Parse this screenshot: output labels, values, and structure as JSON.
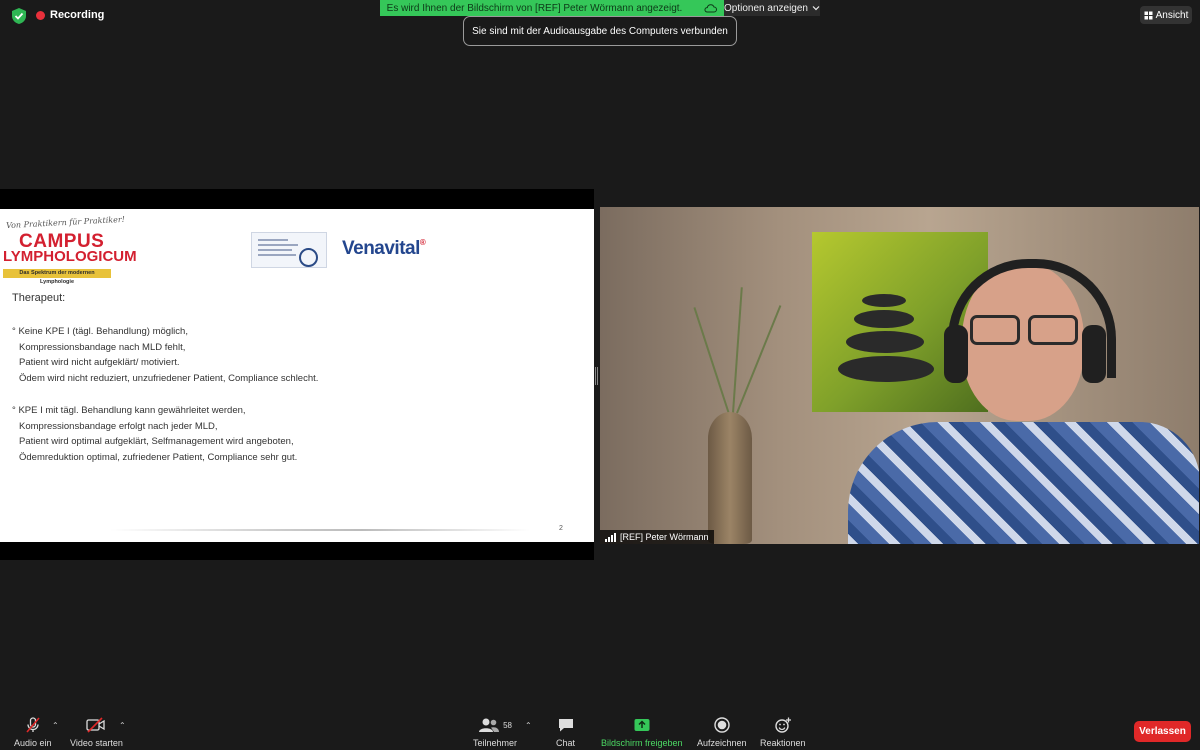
{
  "top_bar": {
    "recording_label": "Recording",
    "share_banner": "Es wird Ihnen der Bildschirm von [REF] Peter Wörmann angezeigt.",
    "options_label": "Optionen anzeigen",
    "audio_toast": "Sie sind mit der Audioausgabe des Computers verbunden",
    "view_label": "Ansicht"
  },
  "slide": {
    "logo_tagline": "Von Praktikern für Praktiker!",
    "logo_campus": "CAMPUS",
    "logo_lympho": "LYMPHOLOGICUM",
    "logo_subtitle": "Das Spektrum der modernen Lymphologie",
    "partner_logo": "Venavital",
    "partner_reg": "®",
    "title": "Therapeut:",
    "bullets": [
      {
        "marker": "°",
        "lines": [
          "Keine KPE I (tägl. Behandlung) möglich,",
          "Kompressionsbandage nach MLD fehlt,",
          "Patient wird nicht aufgeklärt/ motiviert.",
          "Ödem wird nicht reduziert, unzufriedener Patient, Compliance schlecht."
        ]
      },
      {
        "marker": "°",
        "lines": [
          "KPE I mit tägl. Behandlung kann gewährleitet werden,",
          "Kompressionsbandage erfolgt nach jeder MLD,",
          "Patient wird optimal aufgeklärt, Selfmanagement wird angeboten,",
          "Ödemreduktion optimal, zufriedener Patient, Compliance sehr gut."
        ]
      }
    ],
    "page_number": "2"
  },
  "video": {
    "participant_name": "[REF] Peter Wörmann"
  },
  "toolbar": {
    "audio_label": "Audio ein",
    "video_label": "Video starten",
    "participants_label": "Teilnehmer",
    "participants_count": "58",
    "chat_label": "Chat",
    "share_label": "Bildschirm freigeben",
    "record_label": "Aufzeichnen",
    "reactions_label": "Reaktionen",
    "leave_label": "Verlassen"
  },
  "colors": {
    "share_green": "#35c759",
    "leave_red": "#e02828",
    "recording_red": "#e8303b"
  }
}
